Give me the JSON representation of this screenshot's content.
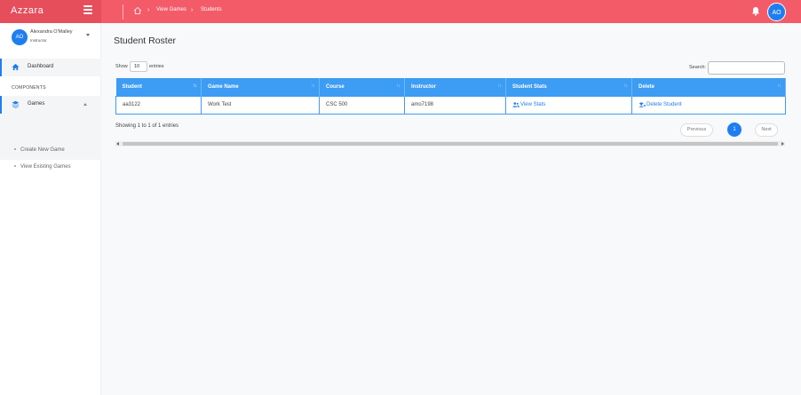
{
  "app": {
    "brand": "Azzara"
  },
  "breadcrumb": {
    "items": [
      "View Games",
      "Students"
    ]
  },
  "user": {
    "initials": "AO",
    "name": "Alexandra O'Malley",
    "role": "Instructor"
  },
  "sidebar": {
    "dashboard_label": "Dashboard",
    "section_title": "COMPONENTS",
    "games_label": "Games",
    "sub_items": [
      "Create New Game",
      "View Existing Games"
    ]
  },
  "page": {
    "title": "Student Roster"
  },
  "table_controls": {
    "show_label": "Show",
    "entries_value": "10",
    "entries_label": "entries",
    "search_label": "Search:",
    "search_value": ""
  },
  "table": {
    "columns": [
      "Student",
      "Game Name",
      "Course",
      "Instructor",
      "Student Stats",
      "Delete"
    ],
    "rows": [
      {
        "student": "aa3122",
        "game": "Work Test",
        "course": "CSC 500",
        "instructor": "amo7198",
        "stats_link": "View Stats",
        "delete_link": "Delete Student"
      }
    ]
  },
  "pagination": {
    "info": "Showing 1 to 1 of 1 entries",
    "previous": "Previous",
    "current": "1",
    "next": "Next"
  },
  "colors": {
    "topbar": "#f45b69",
    "brand_area": "#e64e5c",
    "accent": "#1e7ef0",
    "table_header": "#3d9cf3"
  }
}
